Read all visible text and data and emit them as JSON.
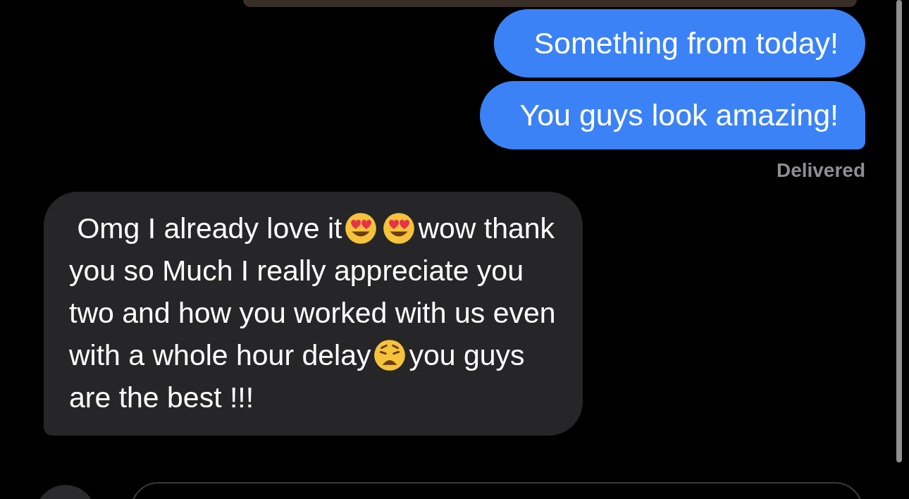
{
  "sent_messages": [
    {
      "text": "Something from today!",
      "tail": false
    },
    {
      "text": "You guys look amazing!",
      "tail": true
    }
  ],
  "delivery_status": "Delivered",
  "received_message": {
    "tail": true,
    "lines": [
      [
        {
          "kind": "text",
          "text": " Omg I already love it"
        },
        {
          "kind": "heart-eyes"
        },
        {
          "kind": "heart-eyes"
        },
        {
          "kind": "text",
          "text": "wow thank"
        }
      ],
      [
        {
          "kind": "text",
          "text": "you so Much I really appreciate you"
        }
      ],
      [
        {
          "kind": "text",
          "text": "two and how you worked with us even"
        }
      ],
      [
        {
          "kind": "text",
          "text": "with a whole hour delay"
        },
        {
          "kind": "weary"
        },
        {
          "kind": "text",
          "text": "you guys"
        }
      ],
      [
        {
          "kind": "text",
          "text": "are the best !!!"
        }
      ]
    ]
  }
}
